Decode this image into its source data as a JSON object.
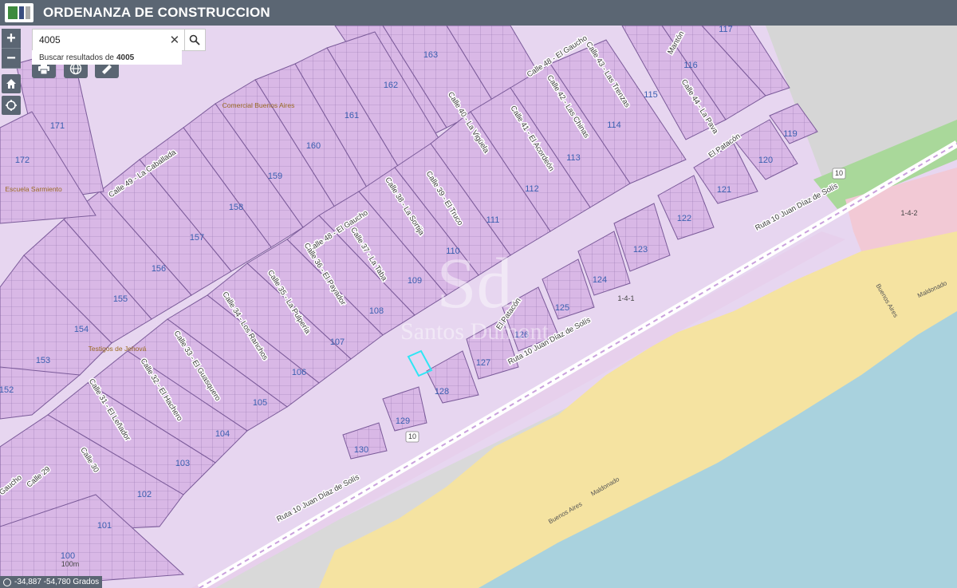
{
  "header": {
    "title": "ORDENANZA DE CONSTRUCCION"
  },
  "search": {
    "value": "4005",
    "results_prefix": "Buscar resultados de",
    "results_term": "4005"
  },
  "zoom": {
    "in_label": "+",
    "out_label": "−"
  },
  "coordinates": "-34,887 -54,780 Grados",
  "map": {
    "watermark": {
      "monogram": "Sd",
      "text": "Santos Dumont"
    },
    "block_labels": [
      {
        "text": "163"
      },
      {
        "text": "162"
      },
      {
        "text": "161"
      },
      {
        "text": "160"
      },
      {
        "text": "159"
      },
      {
        "text": "158"
      },
      {
        "text": "157"
      },
      {
        "text": "156"
      },
      {
        "text": "155"
      },
      {
        "text": "154"
      },
      {
        "text": "153"
      },
      {
        "text": "152"
      },
      {
        "text": "171"
      },
      {
        "text": "172"
      },
      {
        "text": "117"
      },
      {
        "text": "116"
      },
      {
        "text": "115"
      },
      {
        "text": "114"
      },
      {
        "text": "113"
      },
      {
        "text": "112"
      },
      {
        "text": "111"
      },
      {
        "text": "110"
      },
      {
        "text": "109"
      },
      {
        "text": "108"
      },
      {
        "text": "107"
      },
      {
        "text": "106"
      },
      {
        "text": "105"
      },
      {
        "text": "104"
      },
      {
        "text": "103"
      },
      {
        "text": "102"
      },
      {
        "text": "101"
      },
      {
        "text": "100"
      },
      {
        "text": "119"
      },
      {
        "text": "120"
      },
      {
        "text": "121"
      },
      {
        "text": "122"
      },
      {
        "text": "123"
      },
      {
        "text": "124"
      },
      {
        "text": "125"
      },
      {
        "text": "126"
      },
      {
        "text": "127"
      },
      {
        "text": "128"
      },
      {
        "text": "129"
      },
      {
        "text": "130"
      }
    ],
    "street_labels": [
      {
        "text": "Calle 49 - La Caballada"
      },
      {
        "text": "Calle 48 - El Gaucho"
      },
      {
        "text": "Calle 48 - El Gaucho"
      },
      {
        "text": "Calle 43 - Las Trenzas"
      },
      {
        "text": "Calle 42 - Las Chinas"
      },
      {
        "text": "Calle 41 - El Acordeón"
      },
      {
        "text": "Calle 40 - La Vigüela"
      },
      {
        "text": "Calle 39 - El Truco"
      },
      {
        "text": "Calle 38 - La Sortija"
      },
      {
        "text": "Calle 37 - La Taba"
      },
      {
        "text": "Calle 36 - El Payador"
      },
      {
        "text": "Calle 35 - La Pulpería"
      },
      {
        "text": "Calle 34 - Los Ranchos"
      },
      {
        "text": "Calle 33 - El Guasquero"
      },
      {
        "text": "Calle 32 - El Hachero"
      },
      {
        "text": "Calle 31 - El Leñador"
      },
      {
        "text": "Calle 30"
      },
      {
        "text": "Calle 29"
      },
      {
        "text": "Gaucho"
      },
      {
        "text": "Calle 44 - La Pava"
      },
      {
        "text": "Mantón"
      },
      {
        "text": "El Patacón"
      },
      {
        "text": "El Patacón"
      },
      {
        "text": "Ruta 10 Juan Díaz de Solís"
      },
      {
        "text": "Ruta 10 Juan Díaz de Solís"
      },
      {
        "text": "Ruta 10 Juan Díaz de Solís"
      }
    ],
    "route_shields": [
      {
        "text": "10"
      },
      {
        "text": "10"
      }
    ],
    "zone_labels": [
      {
        "text": "1-4-2"
      },
      {
        "text": "1-4-1"
      },
      {
        "text": "100m"
      }
    ],
    "poi_labels": [
      {
        "text": "Comercial Buenos Aires"
      },
      {
        "text": "Testigos de Jehová"
      },
      {
        "text": "Escuela Sarmiento"
      }
    ],
    "place_labels": [
      {
        "text": "Buenos Aires"
      },
      {
        "text": "Maldonado"
      },
      {
        "text": "Buenos Aires"
      },
      {
        "text": "Maldonado"
      }
    ]
  }
}
